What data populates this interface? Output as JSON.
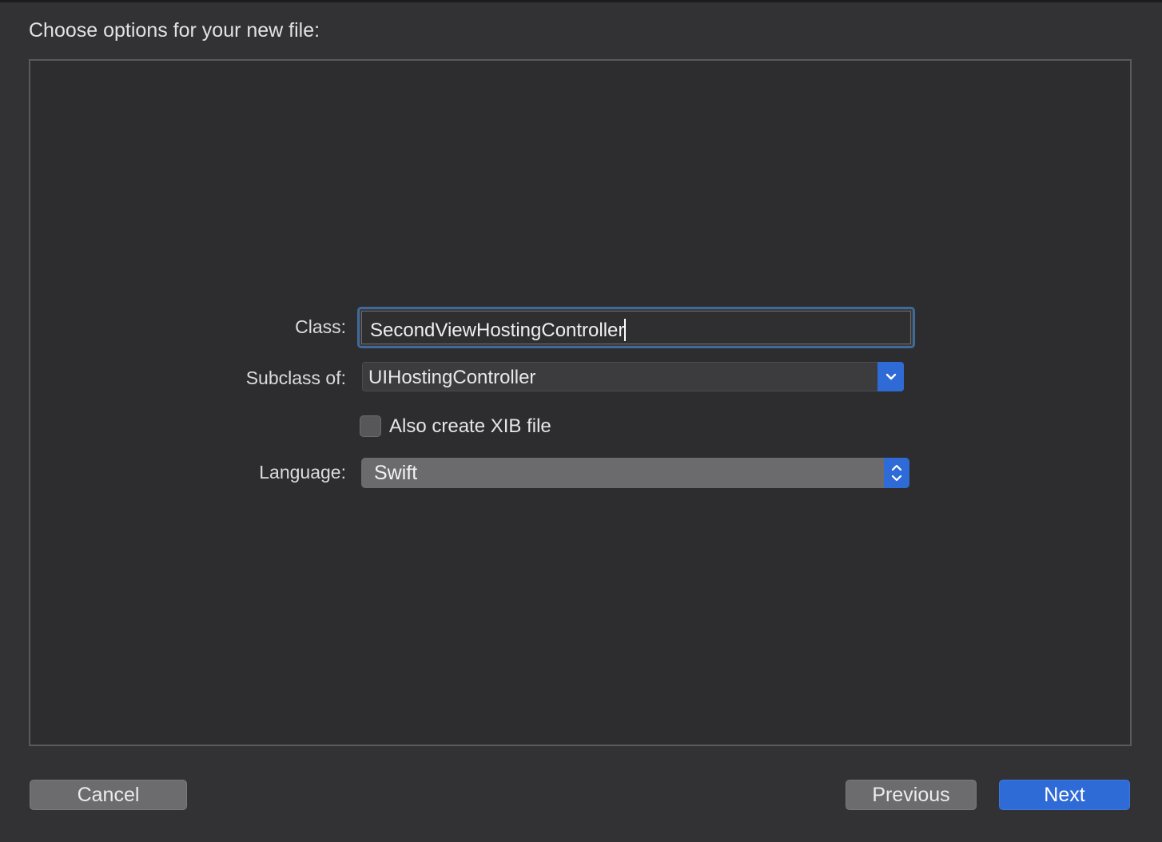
{
  "dialog": {
    "heading": "Choose options for your new file:"
  },
  "form": {
    "class_label": "Class:",
    "class_value": "SecondViewHostingController",
    "subclass_label": "Subclass of:",
    "subclass_value": "UIHostingController",
    "xib_checkbox_label": "Also create XIB file",
    "xib_checked": false,
    "language_label": "Language:",
    "language_value": "Swift"
  },
  "buttons": {
    "cancel": "Cancel",
    "previous": "Previous",
    "next": "Next"
  },
  "icons": {
    "combo_arrow": "chevron-down-icon",
    "popup_arrows": "up-down-chevron-icon"
  },
  "colors": {
    "accent": "#2f6bd6",
    "focus_ring": "#3f6a99",
    "window_bg": "#323235"
  }
}
